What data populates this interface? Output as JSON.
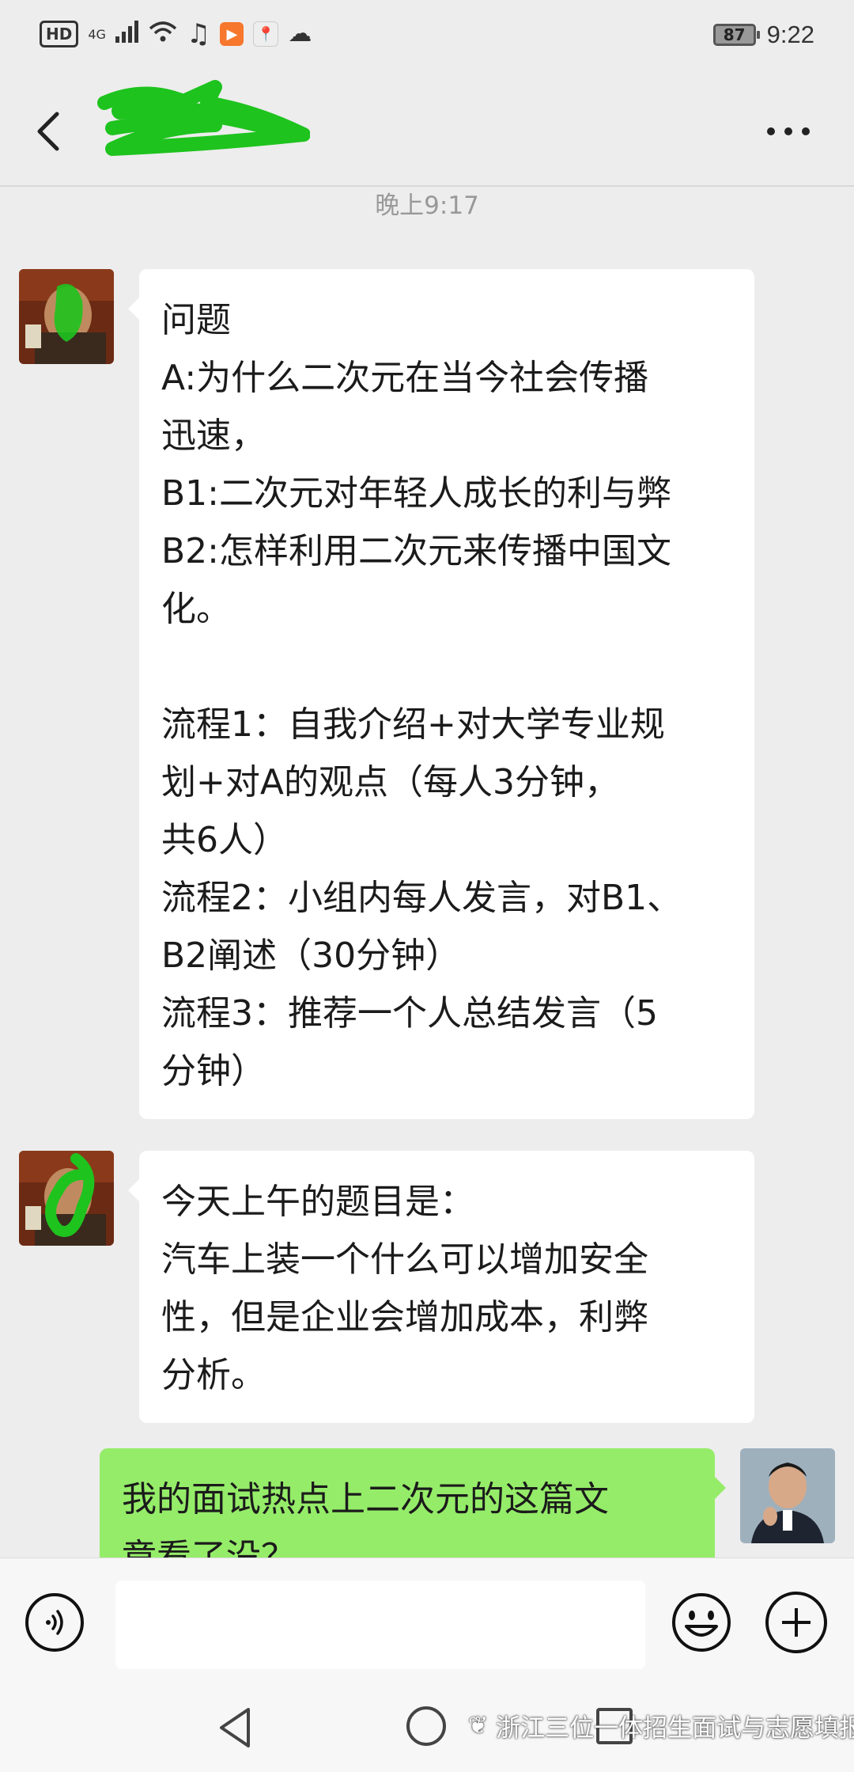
{
  "status_bar": {
    "hd": "HD",
    "network": "4G",
    "battery": "87",
    "time": "9:22"
  },
  "header": {
    "back_icon": "chevron-left-icon",
    "more_icon": "more-dots-icon"
  },
  "chat": {
    "timestamp": "晚上9:17",
    "messages": [
      {
        "side": "left",
        "lines": [
          "问题",
          "A:为什么二次元在当今社会传播",
          "迅速，",
          "B1:二次元对年轻人成长的利与弊",
          "B2:怎样利用二次元来传播中国文",
          "化。",
          "",
          "流程1：自我介绍+对大学专业规",
          "划+对A的观点（每人3分钟，",
          "共6人）",
          "流程2：小组内每人发言，对B1、",
          "B2阐述（30分钟）",
          "流程3：推荐一个人总结发言（5",
          "分钟）"
        ]
      },
      {
        "side": "left",
        "lines": [
          "今天上午的题目是：",
          "汽车上装一个什么可以增加安全",
          "性，但是企业会增加成本，利弊",
          "分析。"
        ]
      },
      {
        "side": "right",
        "lines": [
          "我的面试热点上二次元的这篇文",
          "章看了没？"
        ]
      }
    ]
  },
  "input_bar": {
    "voice_icon": "voice-icon",
    "input_value": "",
    "emoji_icon": "emoji-icon",
    "plus_icon": "plus-icon"
  },
  "watermark": {
    "text": "浙江三位一体招生面试与志愿填报"
  },
  "colors": {
    "background": "#ededed",
    "bubble_left": "#ffffff",
    "bubble_right": "#95ec69",
    "annotation_scribble": "#1ec31e"
  }
}
